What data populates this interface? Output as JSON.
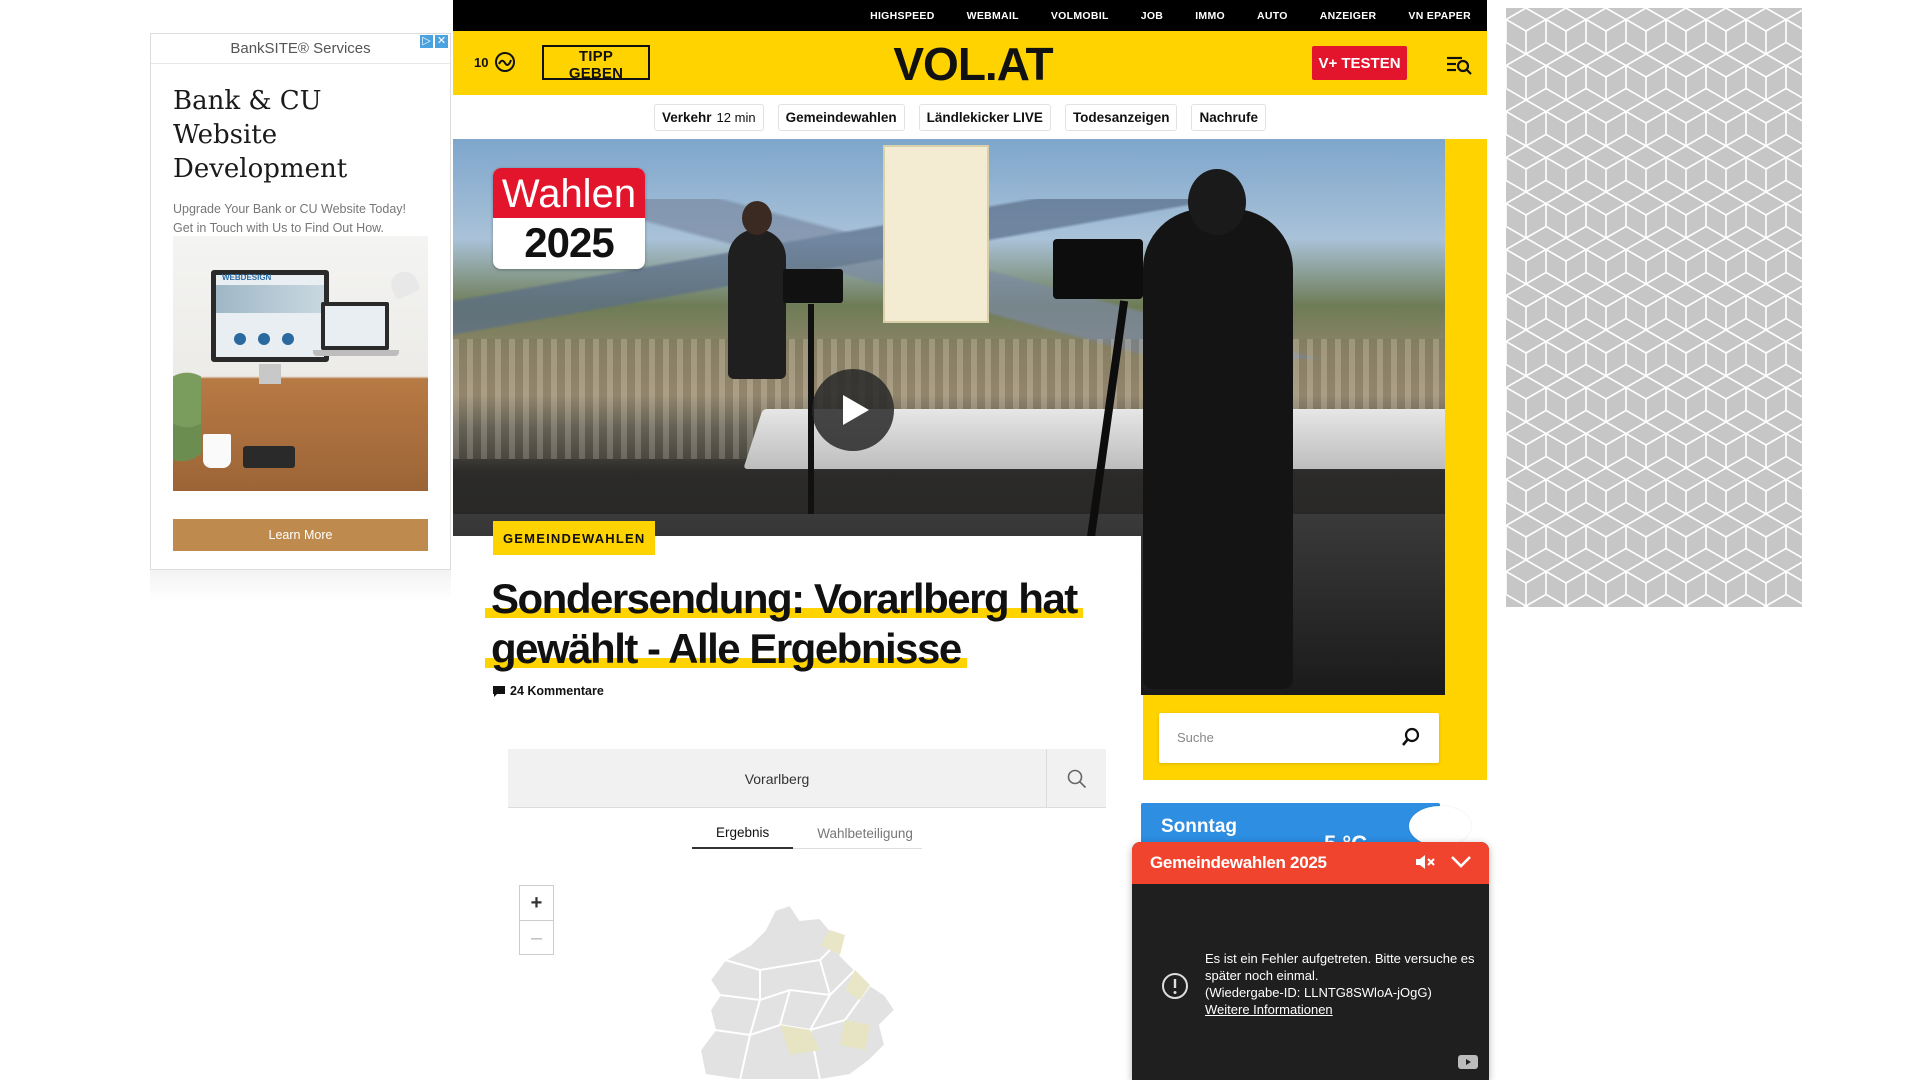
{
  "top_nav": {
    "items": [
      "HIGHSPEED",
      "WEBMAIL",
      "VOLMOBIL",
      "JOB",
      "IMMO",
      "AUTO",
      "ANZEIGER",
      "VN EPAPER"
    ]
  },
  "header": {
    "temperature_count": "10",
    "tipp_button": "TIPP GEBEN",
    "logo": "VOL.AT",
    "vplus_button": "V+ TESTEN",
    "brand_yellow": "#ffd300",
    "brand_red": "#e3152c"
  },
  "quick_links": [
    {
      "label": "Verkehr",
      "sub": "12 min"
    },
    {
      "label": "Gemeindewahlen",
      "sub": ""
    },
    {
      "label": "Ländlekicker LIVE",
      "sub": ""
    },
    {
      "label": "Todesanzeigen",
      "sub": ""
    },
    {
      "label": "Nachrufe",
      "sub": ""
    }
  ],
  "hero": {
    "badge_top": "Wahlen",
    "badge_bottom": "2025"
  },
  "article": {
    "kicker": "GEMEINDEWAHLEN",
    "headline": "Sondersendung: Vorarlberg hat gewählt - Alle Ergebnisse",
    "comments": "24 Kommentare"
  },
  "election": {
    "search_value": "Vorarlberg",
    "tabs": [
      "Ergebnis",
      "Wahlbeteiligung"
    ],
    "active_tab": "Ergebnis",
    "zoom_in": "+",
    "zoom_out": "–"
  },
  "sidebar": {
    "search_placeholder": "Suche",
    "weather_day": "Sonntag",
    "weather_temp": "5 °C"
  },
  "ad_left": {
    "sponsor": "BankSITE® Services",
    "title": "Bank & CU Website Development",
    "text": "Upgrade Your Bank or CU Website Today! Get in Touch with Us to Find Out How.",
    "image_text": "WEBDESIGN",
    "cta": "Learn More"
  },
  "floating_player": {
    "title": "Gemeindewahlen 2025",
    "error_line1": "Es ist ein Fehler aufgetreten. Bitte versuche es später noch einmal.",
    "error_line2": "(Wiedergabe-ID: LLNTG8SWloA-jOgG)",
    "more_link": "Weitere Informationen"
  }
}
